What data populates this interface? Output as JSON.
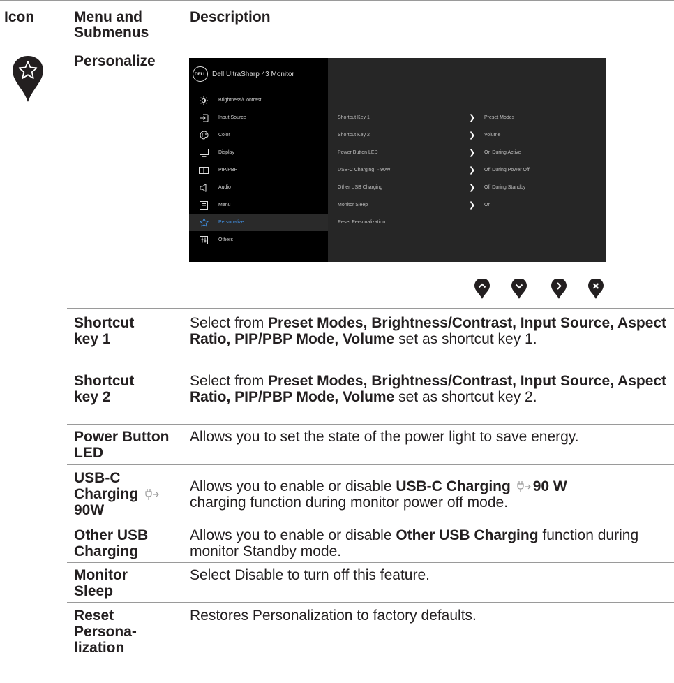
{
  "header": {
    "col_icon": "Icon",
    "col_menu": "Menu and Submenus",
    "col_desc": "Description"
  },
  "section_title": "Personalize",
  "osd": {
    "brand_logo": "DELL",
    "brand_text": "Dell UltraSharp 43 Monitor",
    "menu": [
      {
        "label": "Brightness/Contrast",
        "icon": "brightness-icon"
      },
      {
        "label": "Input Source",
        "icon": "input-source-icon"
      },
      {
        "label": "Color",
        "icon": "color-palette-icon"
      },
      {
        "label": "Display",
        "icon": "display-icon"
      },
      {
        "label": "PIP/PBP",
        "icon": "pip-icon"
      },
      {
        "label": "Audio",
        "icon": "speaker-icon"
      },
      {
        "label": "Menu",
        "icon": "menu-icon"
      },
      {
        "label": "Personalize",
        "icon": "star-icon",
        "active": true
      },
      {
        "label": "Others",
        "icon": "others-icon"
      }
    ],
    "settings": [
      {
        "name": "Shortcut Key 1",
        "value": "Preset Modes"
      },
      {
        "name": "Shortcut Key 2",
        "value": "Volume"
      },
      {
        "name": "Power Button LED",
        "value": "On During Active"
      },
      {
        "name": "USB-C Charging ⇔90W",
        "value": "Off During Power Off"
      },
      {
        "name": "Other USB Charging",
        "value": "Off During Standby"
      },
      {
        "name": "Monitor Sleep",
        "value": "On"
      },
      {
        "name": "Reset Personalization",
        "value": ""
      }
    ],
    "accent_color": "#3f8ad8"
  },
  "nav_buttons": [
    "up-button",
    "down-button",
    "right-button",
    "close-button"
  ],
  "rows": [
    {
      "name": "Shortcut key 1",
      "desc_html": "Select from <b>Preset Modes, Brightness/Contrast, Input Source, Aspect Ratio, PIP/PBP Mode, Volume</b> set as shortcut key 1."
    },
    {
      "name": "Shortcut key 2",
      "desc_html": "Select from <b>Preset Modes, Brightness/Contrast, Input Source, Aspect Ratio, PIP/PBP Mode, Volume</b> set as shortcut key 2."
    },
    {
      "name": "Power Button LED",
      "desc": "Allows you to set the state of the power light to save energy."
    },
    {
      "name": "USB-C Charging 90W",
      "desc_pre": "Allows you to enable or disable ",
      "desc_bold": "USB-C Charging",
      "desc_bold2": "90 W",
      "desc_post": "charging function during monitor power off mode."
    },
    {
      "name": "Other USB Charging",
      "desc_pre": "Allows you to enable or disable ",
      "desc_bold": "Other USB Charging",
      "desc_post": " function during monitor Standby mode."
    },
    {
      "name": "Monitor Sleep",
      "desc": "Select Disable to turn off this feature."
    },
    {
      "name": "Reset Personalization",
      "desc": "Restores Personalization to factory defaults."
    }
  ],
  "row_names_display": {
    "r1a": "Shortcut",
    "r1b": "key 1",
    "r2a": "Shortcut",
    "r2b": "key 2",
    "r3a": "Power Button",
    "r3b": "LED",
    "r4a": "USB-C",
    "r4b": "Charging",
    "r4c": "90W",
    "r5a": "Other USB",
    "r5b": "Charging",
    "r6a": "Monitor",
    "r6b": "Sleep",
    "r7a": "Reset",
    "r7b": "Persona-",
    "r7c": "lization"
  },
  "desc_display": {
    "d1_pre": "Select from ",
    "d1_bold": "Preset Modes, Brightness/Contrast, Input Source, Aspect Ratio, PIP/PBP Mode, Volume",
    "d1_post": " set as shortcut key 1.",
    "d2_pre": "Select from ",
    "d2_bold": "Preset Modes, Brightness/Contrast, Input Source, Aspect Ratio, PIP/PBP Mode, Volume",
    "d2_post": " set as shortcut key 2."
  }
}
